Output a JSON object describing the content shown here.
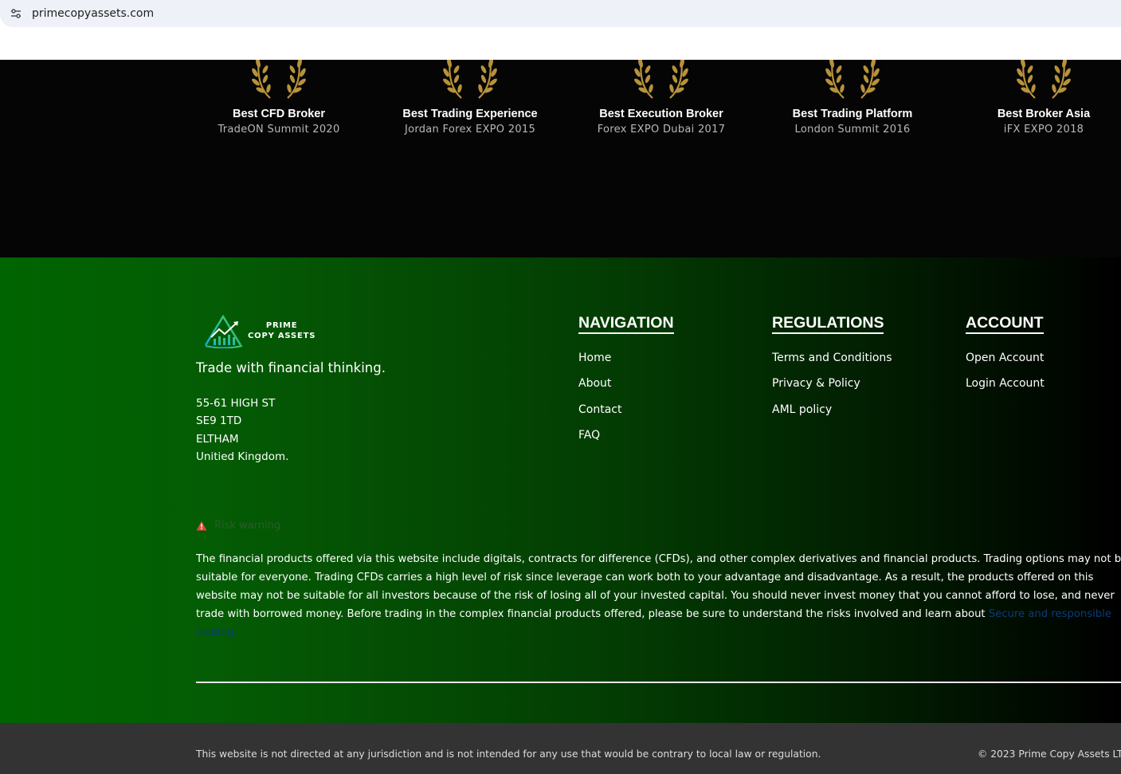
{
  "browser": {
    "url": "primecopyassets.com",
    "site_info_icon": "tune-icon"
  },
  "awards": [
    {
      "title": "Best CFD Broker",
      "subtitle": "TradeON Summit 2020",
      "icon": "laurel-wreath-icon"
    },
    {
      "title": "Best Trading Experience",
      "subtitle": "Jordan Forex EXPO 2015",
      "icon": "laurel-wreath-icon"
    },
    {
      "title": "Best Execution Broker",
      "subtitle": "Forex EXPO Dubai 2017",
      "icon": "laurel-wreath-icon"
    },
    {
      "title": "Best Trading Platform",
      "subtitle": "London Summit 2016",
      "icon": "laurel-wreath-icon"
    },
    {
      "title": "Best Broker Asia",
      "subtitle": "iFX EXPO 2018",
      "icon": "laurel-wreath-icon"
    }
  ],
  "footer": {
    "logo": {
      "line1": "PRIME",
      "line2": "COPY ASSETS",
      "icon": "chart-growth-logo-icon"
    },
    "tagline": "Trade with financial thinking.",
    "address": [
      "55-61 HIGH ST",
      "SE9 1TD",
      "ELTHAM",
      "Unitied Kingdom."
    ],
    "navigation": {
      "heading": "NAVIGATION",
      "items": [
        "Home",
        "About",
        "Contact",
        "FAQ"
      ]
    },
    "regulations": {
      "heading": "REGULATIONS",
      "items": [
        "Terms and Conditions",
        "Privacy & Policy",
        "AML policy"
      ]
    },
    "account": {
      "heading": "ACCOUNT",
      "items": [
        "Open Account",
        "Login Account"
      ]
    },
    "risk": {
      "label": "Risk warning",
      "icon": "warning-triangle-icon",
      "text": "The financial products offered via this website include digitals, contracts for difference (CFDs), and other complex derivatives and financial products. Trading options may not be suitable for everyone. Trading CFDs carries a high level of risk since leverage can work both to your advantage and disadvantage. As a result, the products offered on this website may not be suitable for all investors because of the risk of losing all of your invested capital. You should never invest money that you cannot afford to lose, and never trade with borrowed money. Before trading in the complex financial products offered, please be sure to understand the risks involved and learn about",
      "link_text": "Secure and responsible trading."
    }
  },
  "bottom_bar": {
    "disclaimer": "This website is not directed at any jurisdiction and is not intended for any use that would be contrary to local law or regulation.",
    "copyright": "© 2023 Prime Copy Assets LT"
  },
  "colors": {
    "awards_bg": "#050505",
    "laurel_gold": "#b8923a",
    "footer_green": "#006400",
    "bottom_bar_bg": "#333333",
    "risk_icon_red": "#e0463c",
    "link_blue": "#0b3c78"
  }
}
